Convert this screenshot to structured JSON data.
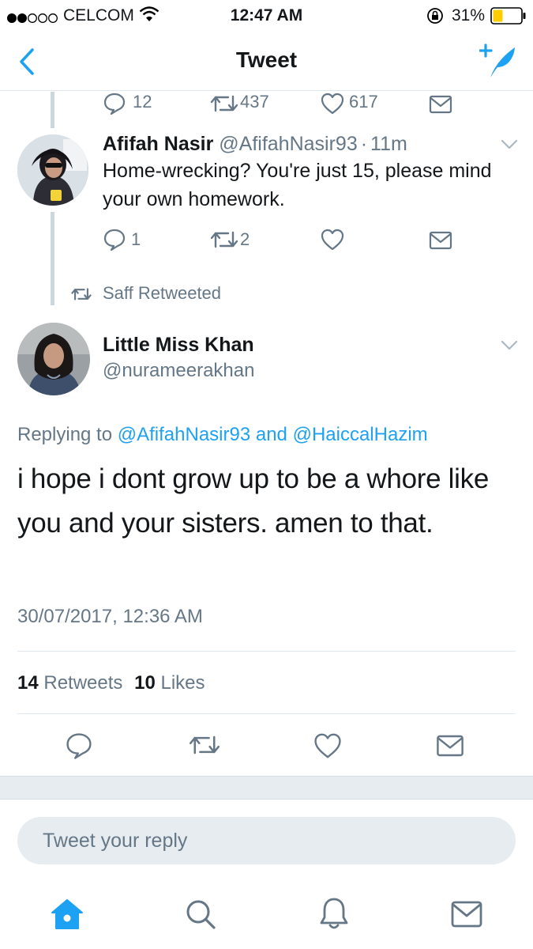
{
  "status_bar": {
    "carrier": "CELCOM",
    "time": "12:47 AM",
    "battery": "31%"
  },
  "nav": {
    "back_icon": "chevron-left-icon",
    "title": "Tweet",
    "compose_icon": "compose-tweet-icon"
  },
  "prev_tweet_actions": {
    "replies": "12",
    "retweets": "437",
    "likes": "617"
  },
  "reply_tweet": {
    "name": "Afifah Nasir",
    "handle": "@AfifahNasir93",
    "sep": "·",
    "age": "11m",
    "text": "Home-wrecking? You're just 15, please mind your own homework.",
    "replies": "1",
    "retweets": "2"
  },
  "retweet_context": {
    "label": "Saff Retweeted"
  },
  "main_tweet": {
    "name": "Little Miss Khan",
    "handle": "@nurameerakhan",
    "replying_prefix": "Replying to ",
    "replying_user1": "@AfifahNasir93",
    "replying_and": " and ",
    "replying_user2": "@HaiccalHazim",
    "text": "i hope i dont grow up to be a whore like you and your sisters. amen to that.",
    "timestamp": "30/07/2017, 12:36 AM",
    "retweet_count": "14",
    "retweet_label": "Retweets",
    "like_count": "10",
    "like_label": "Likes"
  },
  "reply_box": {
    "placeholder": "Tweet your reply"
  },
  "tab_bar": {
    "home_icon": "home-icon",
    "search_icon": "search-icon",
    "notifications_icon": "bell-icon",
    "messages_icon": "mail-icon"
  },
  "colors": {
    "accent": "#1da1f2",
    "secondary_text": "#657786",
    "battery_fill": "#ffcc00"
  }
}
